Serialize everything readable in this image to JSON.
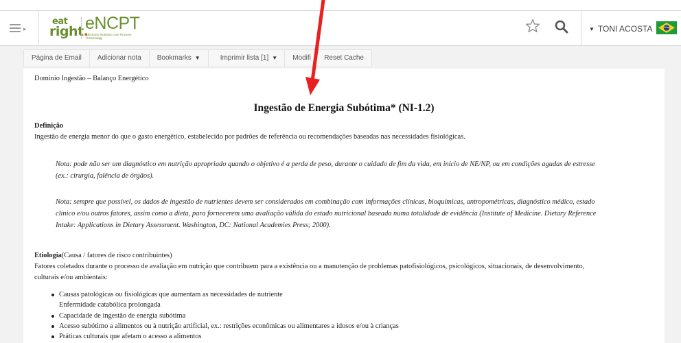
{
  "header": {
    "logo": {
      "eat": "eat",
      "right": "right",
      "product": "eNCPT",
      "subtitle": "Electronic Nutrition Care Process Terminology"
    },
    "user_name": "TONI ACOSTA",
    "icons": [
      "menu-icon",
      "star-icon",
      "search-icon",
      "chevron-down-icon",
      "brazil-flag-icon"
    ]
  },
  "toolbar": {
    "email_page": "Página de Email",
    "add_note": "Adicionar nota",
    "bookmarks": "Bookmarks",
    "print_list": "Imprimir lista [1]",
    "modify": "Modifi",
    "reset_cache": "Reset Cache"
  },
  "content": {
    "breadcrumb": "Domínio Ingestão – Balanço Energético",
    "title": "Ingestão de Energia Subótima* (NI-1.2)",
    "definition": {
      "heading": "Definição",
      "text": "Ingestão de energia menor do que o gasto energético, estabelecido por padrões de referência ou recomendações baseadas nas necessidades fisiológicas."
    },
    "notes": [
      {
        "line1": "Nota: pode não ser um diagnóstico em nutrição apropriado quando o objetivo é a perda de peso, durante o cuidado de fim da vida, em início de NE/NP, ou em condições agudas de estresse",
        "line2": "(ex.: cirurgia, falência de órgãos)."
      },
      {
        "line1": "Nota: sempre que possível, os dados de ingestão de nutrientes devem ser considerados em combinação com informações clínicas, bioquímicas, antropométricas, diagnóstico médico, estado",
        "line2": "clínico e/ou outros fatores, assim como a dieta, para fornecerem uma avaliação válida do estado nutricional baseada numa totalidade de evidência (Institute of Medicine. Dietary Reference",
        "line3": "Intake: Applications in Dietary Assessment. Washington, DC: National Academies Press; 2000)."
      }
    ],
    "etiology": {
      "heading": "Etiologia",
      "heading_suffix": "(Causa / fatores de risco contribuintes)",
      "line1": "Fatores coletados durante o processo de avaliação em nutrição que contribuem para a existência ou a manutenção de problemas patofisiológicos, psicológicos, situacionais, de desenvolvimento,",
      "line2": "culturais e/ou ambientais:",
      "items": [
        "Causas patológicas ou fisiológicas que aumentam as necessidades de nutriente",
        "Enfermidade catabólica prolongada",
        "Capacidade de ingestão de energia subótima",
        "Acesso subótimo a alimentos ou à nutrição artificial, ex.: restrições econômicas ou alimentares a idosos e/ou à crianças",
        "Práticas culturais que afetam o acesso a alimentos"
      ]
    }
  },
  "colors": {
    "brand_green": "#6a8f2f",
    "annotation_red": "#e8201f",
    "page_bg": "#f2f2f2"
  }
}
